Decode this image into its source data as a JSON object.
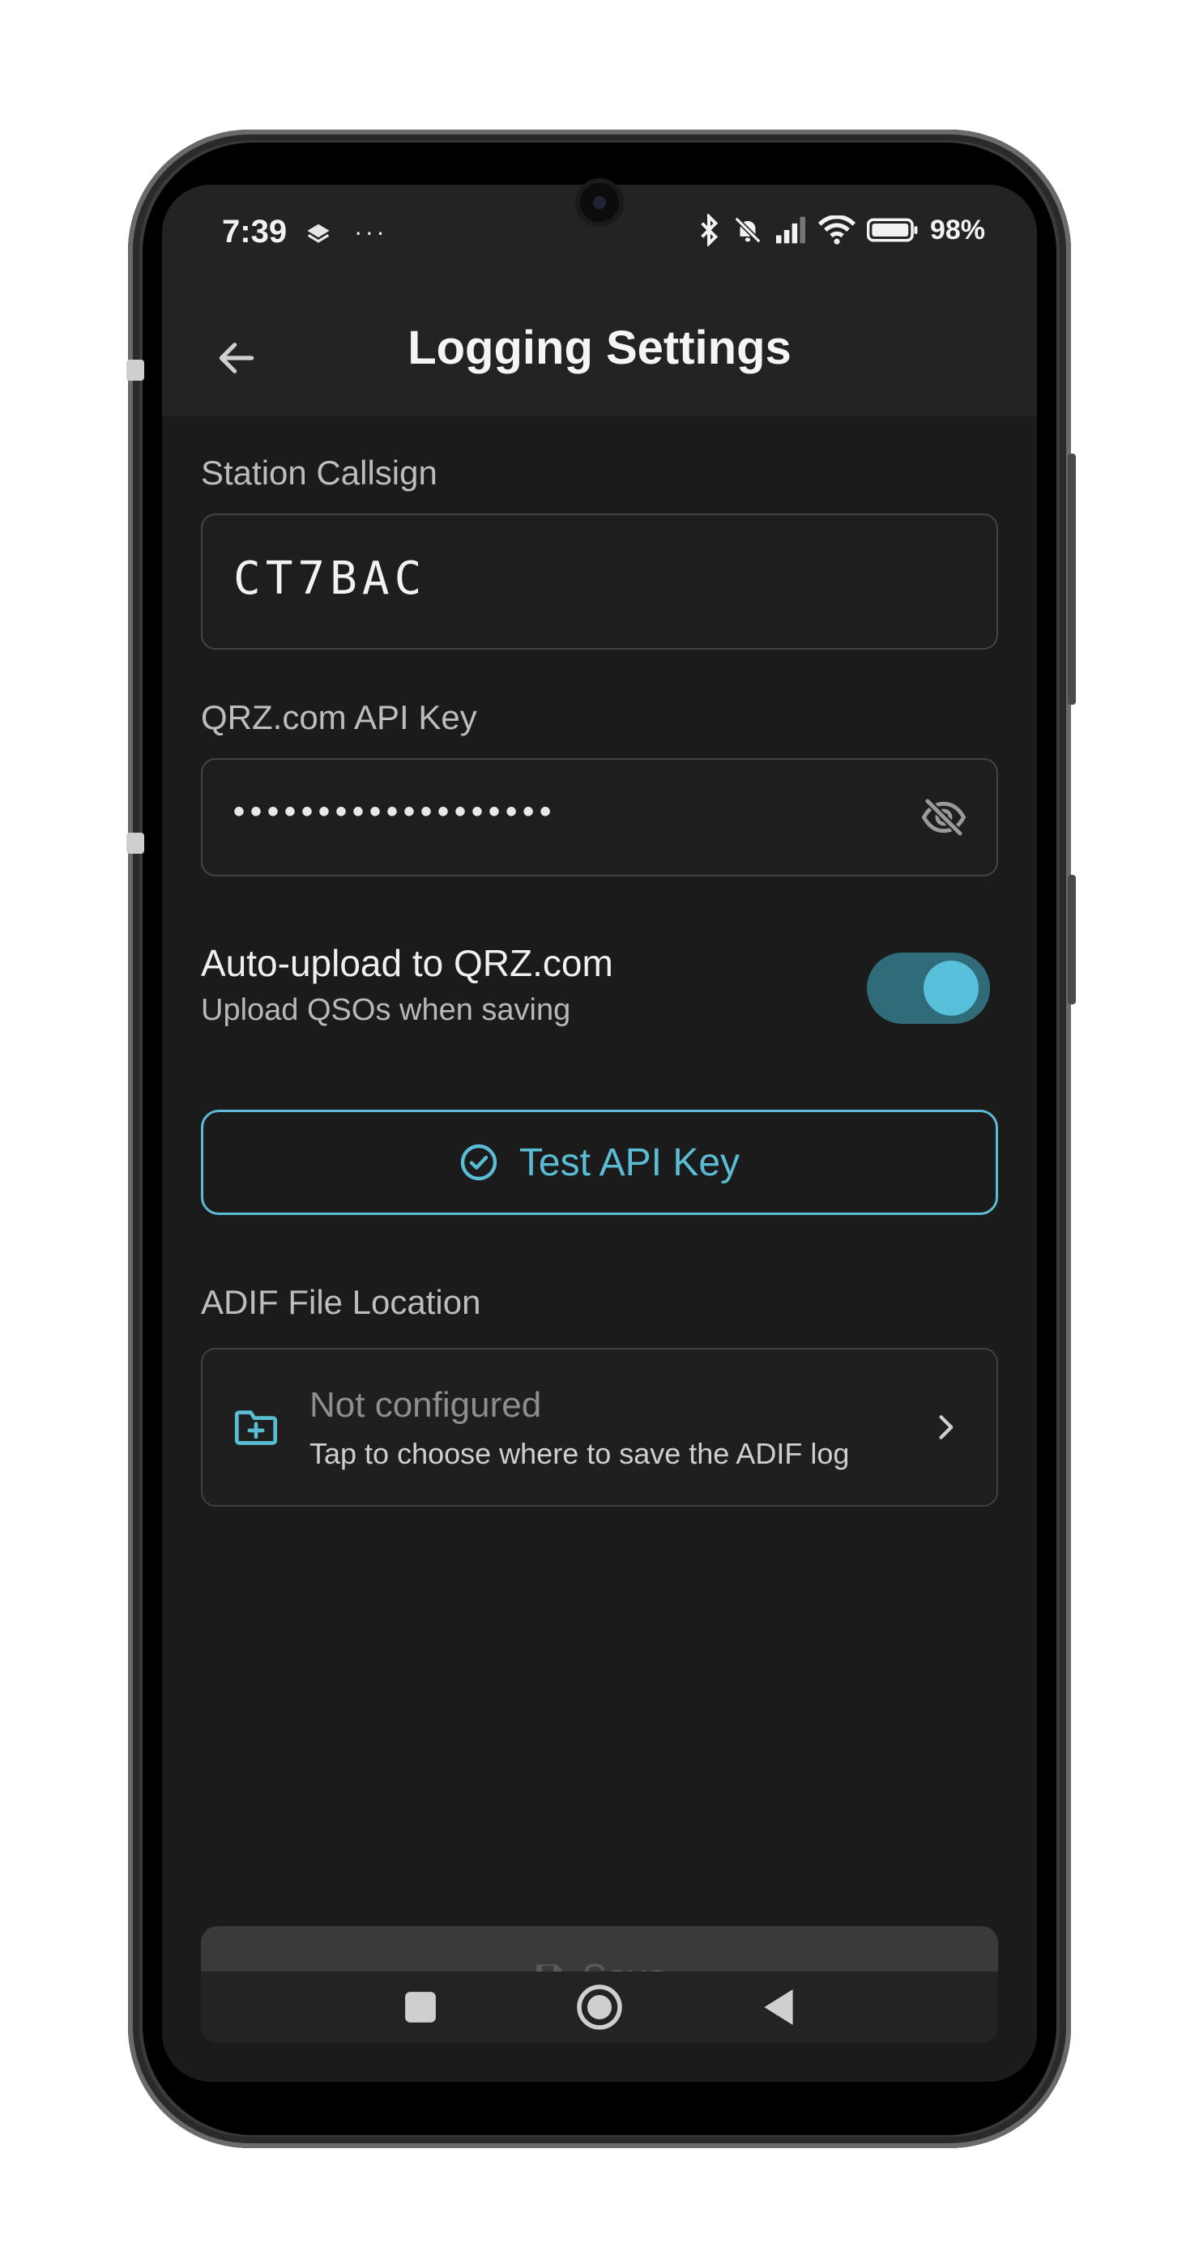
{
  "status_bar": {
    "time": "7:39",
    "left_icons": [
      "layers-icon",
      "more-icon"
    ],
    "battery": "98%"
  },
  "app_bar": {
    "title": "Logging Settings"
  },
  "station_callsign": {
    "label": "Station Callsign",
    "value": "CT7BAC"
  },
  "api_key": {
    "label": "QRZ.com API Key",
    "masked_value": "•••••••••••••••••••"
  },
  "auto_upload": {
    "title": "Auto-upload to QRZ.com",
    "subtitle": "Upload QSOs when saving",
    "enabled": true
  },
  "test_button": {
    "label": "Test API Key"
  },
  "adif": {
    "label": "ADIF File Location",
    "title": "Not configured",
    "subtitle": "Tap to choose where to save the ADIF log"
  },
  "save_button": {
    "label": "Save"
  },
  "colors": {
    "accent": "#5bbcd6",
    "background": "#1b1b1b",
    "app_bar": "#232323"
  }
}
